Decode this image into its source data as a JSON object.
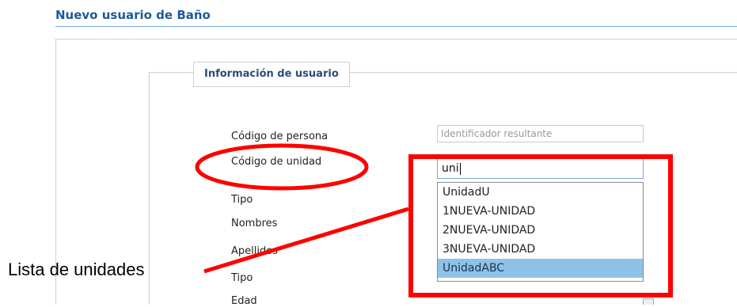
{
  "page": {
    "title": "Nuevo usuario de Baño"
  },
  "section": {
    "legend": "Información de usuario"
  },
  "form": {
    "labels": {
      "codigo_persona": "Código de persona",
      "codigo_unidad": "Código de unidad",
      "tipo1": "Tipo",
      "nombres": "Nombres",
      "apellidos": "Apellidos",
      "tipo2": "Tipo",
      "edad": "Edad"
    },
    "codigo_persona_placeholder": "Identificador resultante",
    "codigo_unidad_value": "uni"
  },
  "dropdown": {
    "options": [
      "UnidadU",
      "1NUEVA-UNIDAD",
      "2NUEVA-UNIDAD",
      "3NUEVA-UNIDAD",
      "UnidadABC"
    ],
    "highlighted": "UnidadABC"
  },
  "annotation": {
    "label": "Lista de unidades",
    "color": "#ff0000"
  },
  "colors": {
    "title": "#1d5a9a",
    "highlight": "#8ec2e6"
  }
}
